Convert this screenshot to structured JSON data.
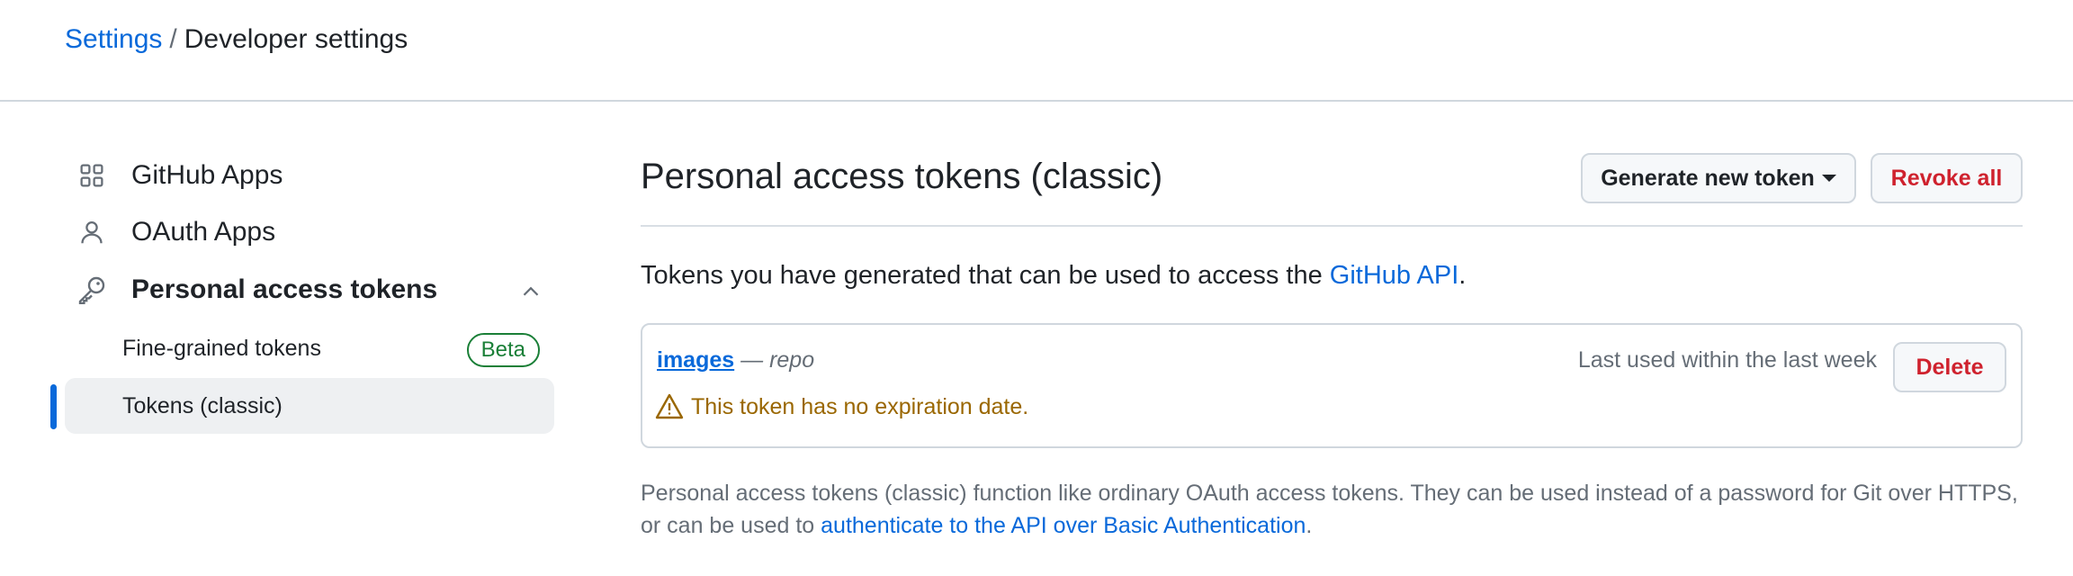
{
  "breadcrumb": {
    "root": "Settings",
    "separator": "/",
    "current": "Developer settings"
  },
  "sidebar": {
    "items": [
      {
        "label": "GitHub Apps",
        "icon": "apps-icon"
      },
      {
        "label": "OAuth Apps",
        "icon": "person-icon"
      },
      {
        "label": "Personal access tokens",
        "icon": "key-icon",
        "expanded": true
      }
    ],
    "sub_items": [
      {
        "label": "Fine-grained tokens",
        "badge": "Beta"
      },
      {
        "label": "Tokens (classic)",
        "active": true
      }
    ]
  },
  "main": {
    "title": "Personal access tokens (classic)",
    "generate_button": "Generate new token",
    "revoke_button": "Revoke all",
    "description": "Tokens you have generated that can be used to access the ",
    "description_link": "GitHub API",
    "description_end": "."
  },
  "token": {
    "name": "images",
    "scope_separator": " — ",
    "scope": "repo",
    "last_used": "Last used within the last week",
    "delete_button": "Delete",
    "warning": "This token has no expiration date."
  },
  "footer": {
    "text": "Personal access tokens (classic) function like ordinary OAuth access tokens. They can be used instead of a password for Git over HTTPS, or can be used to ",
    "link": "authenticate to the API over Basic Authentication",
    "text_end": "."
  },
  "colors": {
    "link": "#0969da",
    "danger": "#cf222e",
    "success": "#1a7f37",
    "warning": "#9a6700",
    "border": "#d0d7de"
  }
}
